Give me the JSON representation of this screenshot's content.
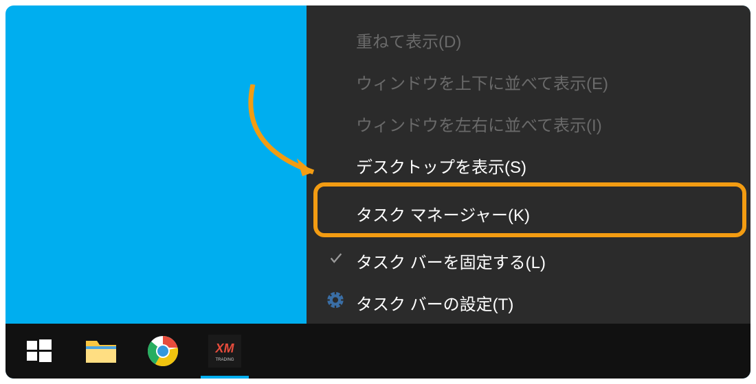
{
  "menu": {
    "items": [
      {
        "label": "重ねて表示(D)",
        "enabled": false,
        "icon": null
      },
      {
        "label": "ウィンドウを上下に並べて表示(E)",
        "enabled": false,
        "icon": null
      },
      {
        "label": "ウィンドウを左右に並べて表示(I)",
        "enabled": false,
        "icon": null
      },
      {
        "label": "デスクトップを表示(S)",
        "enabled": true,
        "icon": null
      },
      {
        "label": "タスク マネージャー(K)",
        "enabled": true,
        "icon": null,
        "highlighted": true
      },
      {
        "label": "タスク バーを固定する(L)",
        "enabled": true,
        "icon": "check"
      },
      {
        "label": "タスク バーの設定(T)",
        "enabled": true,
        "icon": "gear"
      }
    ]
  },
  "taskbar": {
    "items": [
      {
        "name": "start",
        "label": "Start"
      },
      {
        "name": "file-explorer",
        "label": "File Explorer"
      },
      {
        "name": "chrome",
        "label": "Google Chrome"
      },
      {
        "name": "xm-trading",
        "label": "XM Trading",
        "active": true
      }
    ]
  },
  "colors": {
    "desktop": "#00aeef",
    "menu_bg": "#2b2b2b",
    "highlight": "#f39c12"
  }
}
